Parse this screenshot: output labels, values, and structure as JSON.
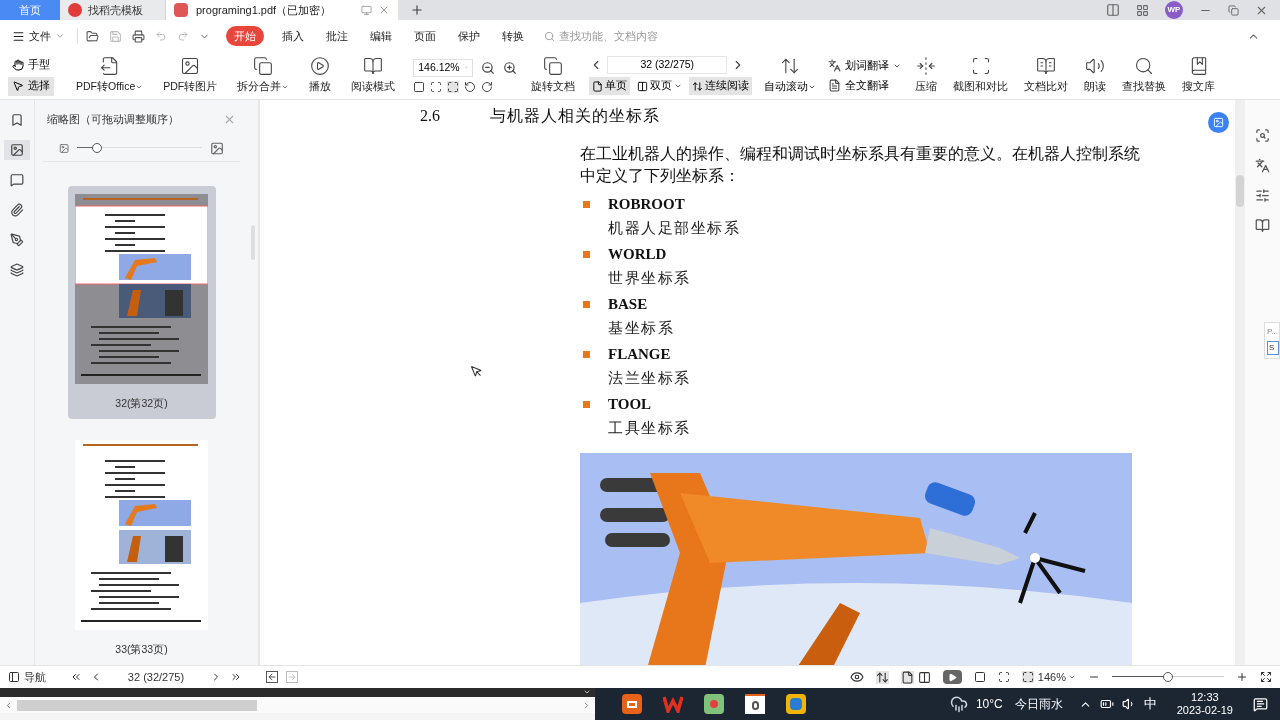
{
  "title_bar": {
    "tabs": [
      {
        "kind": "home",
        "label": "首页",
        "selected": false
      },
      {
        "kind": "template",
        "label": "找稻壳模板",
        "selected": false
      },
      {
        "kind": "pdf",
        "label": "programing1.pdf（已加密）",
        "selected": true
      }
    ],
    "avatar": "WP"
  },
  "menu": {
    "file": "文件",
    "tabs": [
      {
        "label": "开始",
        "selected": true
      },
      {
        "label": "插入",
        "selected": false
      },
      {
        "label": "批注",
        "selected": false
      },
      {
        "label": "编辑",
        "selected": false
      },
      {
        "label": "页面",
        "selected": false
      },
      {
        "label": "保护",
        "selected": false
      },
      {
        "label": "转换",
        "selected": false
      }
    ],
    "search": {
      "placeholder": "查找功能、文档内容"
    }
  },
  "toolbar": {
    "pointer_tools": [
      {
        "kind": "hand",
        "label": "手型",
        "selected": false
      },
      {
        "kind": "select",
        "label": "选择",
        "selected": true
      }
    ],
    "left_buttons": [
      {
        "label": "PDF转Office",
        "dropdown": true
      },
      {
        "label": "PDF转图片",
        "dropdown": false
      },
      {
        "label": "拆分合并",
        "dropdown": true
      },
      {
        "label": "播放",
        "dropdown": false
      },
      {
        "label": "阅读模式",
        "dropdown": false
      }
    ],
    "zoom": "146.12%",
    "rotate": "旋转文档",
    "page": "32 (32/275)",
    "view_modes": [
      {
        "kind": "single",
        "label": "单页",
        "selected": true,
        "dropdown": false
      },
      {
        "kind": "double",
        "label": "双页",
        "selected": false,
        "dropdown": true
      },
      {
        "kind": "continuous",
        "label": "连续阅读",
        "selected": true,
        "dropdown": false
      }
    ],
    "auto_scroll": {
      "label": "自动滚动",
      "dropdown": true
    },
    "translate": [
      {
        "kind": "word",
        "label": "划词翻译",
        "dropdown": true
      },
      {
        "kind": "full",
        "label": "全文翻译",
        "dropdown": false
      }
    ],
    "right_buttons": [
      {
        "label": "压缩"
      },
      {
        "label": "截图和对比"
      },
      {
        "label": "文档比对"
      },
      {
        "label": "朗读"
      },
      {
        "label": "查找替换"
      },
      {
        "label": "搜文库"
      }
    ]
  },
  "sidebar": {
    "items": [
      {
        "kind": "bookmark",
        "selected": false
      },
      {
        "kind": "thumbnail",
        "selected": true
      },
      {
        "kind": "comment",
        "selected": false
      },
      {
        "kind": "attachment",
        "selected": false
      },
      {
        "kind": "signature",
        "selected": false
      },
      {
        "kind": "layers",
        "selected": false
      }
    ]
  },
  "thumbnail_panel": {
    "title": "缩略图（可拖动调整顺序）",
    "size_slider": {
      "level": 0.16
    },
    "pages": [
      {
        "label": "32(第32页)",
        "selected": true
      },
      {
        "label": "33(第33页)",
        "selected": false
      }
    ]
  },
  "document": {
    "section_number": "2.6",
    "section_title": "与机器人相关的坐标系",
    "intro": "在工业机器人的操作、编程和调试时坐标系具有重要的意义。在机器人控制系统中定义了下列坐标系：",
    "coordinate_systems": [
      {
        "name": "ROBROOT",
        "description": "机器人足部坐标系"
      },
      {
        "name": "WORLD",
        "description": "世界坐标系"
      },
      {
        "name": "BASE",
        "description": "基坐标系"
      },
      {
        "name": "FLANGE",
        "description": "法兰坐标系"
      },
      {
        "name": "TOOL",
        "description": "工具坐标系"
      }
    ]
  },
  "side_popup": {
    "lines": [
      "P...",
      "S"
    ]
  },
  "status_bar": {
    "nav": "导航",
    "page": "32 (32/275)",
    "zoom": "146%",
    "zoom_slider": {
      "level": 0.5
    },
    "view_modes": [
      {
        "kind": "single",
        "selected": true
      },
      {
        "kind": "double",
        "selected": false
      }
    ]
  },
  "taskbar": {
    "apps": [
      {
        "kind": "slides"
      },
      {
        "kind": "wps"
      },
      {
        "kind": "maps"
      },
      {
        "kind": "sheets"
      },
      {
        "kind": "vm"
      }
    ],
    "weather": {
      "temperature": "10°C",
      "text": "今日雨水"
    },
    "ime": "中",
    "time": "12:33",
    "date": "2023-02-19"
  }
}
